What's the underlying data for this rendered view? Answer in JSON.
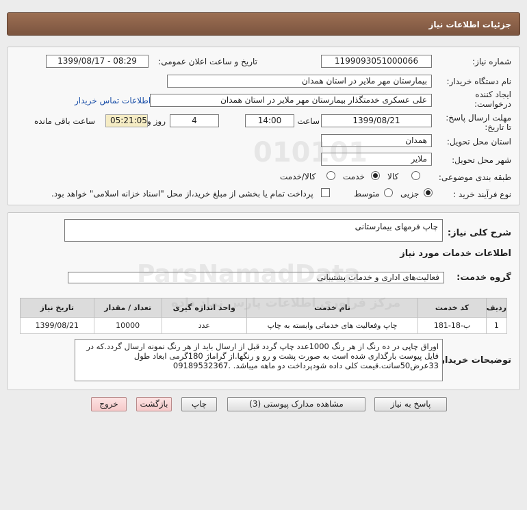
{
  "page": {
    "title": "جزئیات اطلاعات نیاز"
  },
  "form": {
    "need_number_label": "شماره نیاز:",
    "need_number": "1199093051000066",
    "announce_label": "تاریخ و ساعت اعلان عمومی:",
    "announce_value": "1399/08/17 - 08:29",
    "buyer_org_label": "نام دستگاه خریدار:",
    "buyer_org": "بیمارستان مهر ملایر در استان همدان",
    "creator_label_1": "ایجاد کننده",
    "creator_label_2": "درخواست:",
    "creator": "علی عسکری خدمتگذار بیمارستان مهر ملایر در استان همدان",
    "contact_link": "اطلاعات تماس خریدار",
    "deadline_label_1": "مهلت ارسال پاسخ:",
    "deadline_label_2": "تا تاریخ:",
    "deadline_date": "1399/08/21",
    "time_label": "ساعت",
    "deadline_time": "14:00",
    "days_value": "4",
    "days_label": "روز و",
    "remaining_time": "05:21:05",
    "remaining_label": "ساعت باقی مانده",
    "province_label": "استان محل تحویل:",
    "province": "همدان",
    "city_label": "شهر محل تحویل:",
    "city": "ملایر",
    "category_label": "طبقه بندی موضوعی:",
    "category_options": [
      "کالا",
      "خدمت",
      "کالا/خدمت"
    ],
    "category_selected": "خدمت",
    "process_label": "نوع فرآیند خرید :",
    "process_options": [
      "جزیی",
      "متوسط"
    ],
    "process_selected": "جزیی",
    "payment_note": "پرداخت تمام یا بخشی از مبلغ خرید،از محل \"اسناد خزانه اسلامی\" خواهد بود."
  },
  "general": {
    "desc_label": "شرح کلی نیاز:",
    "desc_value": "چاپ فرمهای بیمارستانی",
    "services_heading": "اطلاعات خدمات مورد نیاز",
    "group_label": "گروه خدمت:",
    "group_value": "فعالیت‌های اداری و خدمات پشتیبانی"
  },
  "table": {
    "headers": [
      "ردیف",
      "کد خدمت",
      "نام خدمت",
      "واحد اندازه گیری",
      "تعداد / مقدار",
      "تاریخ نیاز"
    ],
    "rows": [
      [
        "1",
        "ب-18-181",
        "چاپ وفعالیت های خدماتی وابسته به چاپ",
        "عدد",
        "10000",
        "1399/08/21"
      ]
    ]
  },
  "buyer_notes": {
    "label": "توضیحات خریدار:",
    "text": "اوراق چاپی در ده رنگ از هر رنگ 1000عدد چاپ گردد قبل از ارسال باید از هر رنگ نمونه ارسال گردد.که در فایل پیوست بارگذاری شده است به صورت پشت و رو و رنگها.از گراماژ 180گرمی ابعاد طول 33عرض50سانت.قیمت کلی داده شودپرداخت دو ماهه میباشد. .09189532367"
  },
  "buttons": {
    "reply": "پاسخ به نیاز",
    "attachments": "مشاهده مدارک پیوستی (3)",
    "print": "چاپ",
    "back": "بازگشت",
    "exit": "خروج"
  },
  "watermark": {
    "digits": "010101",
    "brand": "ParsNamadData",
    "slogan": "مرکز فراوری اطلاعات پارس نماد داده"
  }
}
